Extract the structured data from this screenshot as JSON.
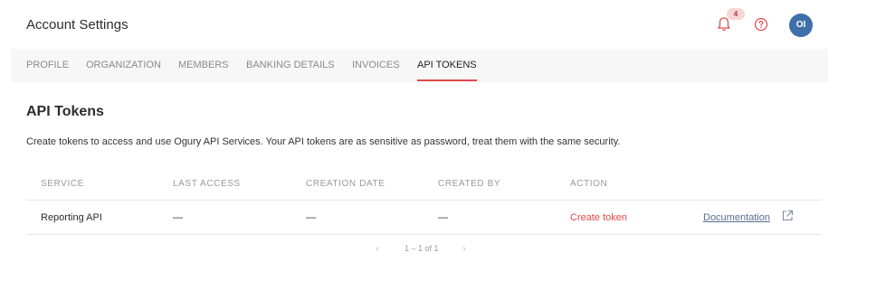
{
  "header": {
    "title": "Account Settings",
    "notifications_count": "4",
    "avatar_initials": "OI"
  },
  "tabs": [
    {
      "label": "PROFILE",
      "active": false
    },
    {
      "label": "ORGANIZATION",
      "active": false
    },
    {
      "label": "MEMBERS",
      "active": false
    },
    {
      "label": "BANKING DETAILS",
      "active": false
    },
    {
      "label": "INVOICES",
      "active": false
    },
    {
      "label": "API TOKENS",
      "active": true
    }
  ],
  "section": {
    "title": "API Tokens",
    "description": "Create tokens to access and use Ogury API Services. Your API tokens are as sensitive as password, treat them with the same security."
  },
  "table": {
    "columns": [
      "SERVICE",
      "LAST ACCESS",
      "CREATION DATE",
      "CREATED BY",
      "ACTION"
    ],
    "rows": [
      {
        "service": "Reporting API",
        "last_access": "—",
        "creation_date": "—",
        "created_by": "—",
        "action": "Create token",
        "doc_link": "Documentation"
      }
    ]
  },
  "pagination": {
    "info": "1 – 1 of 1",
    "prev_glyph": "‹",
    "next_glyph": "›"
  },
  "colors": {
    "accent": "#e04a4a",
    "avatar": "#3f6fa8",
    "badge_bg": "#f6d5d5"
  },
  "icons": {
    "bell": "bell-icon",
    "help": "question-circle-icon",
    "external": "external-link-icon"
  }
}
